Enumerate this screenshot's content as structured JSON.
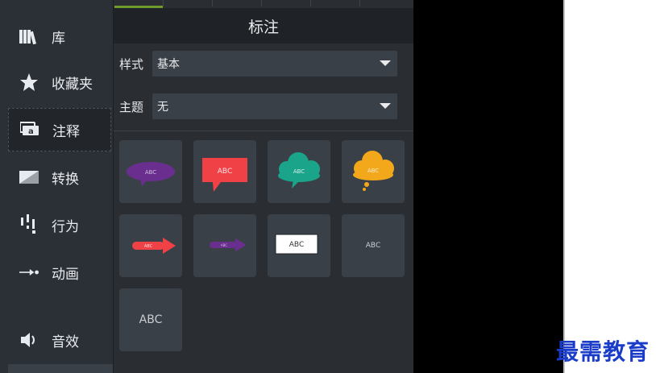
{
  "sidebar": {
    "items": [
      {
        "label": "库",
        "icon": "library-icon"
      },
      {
        "label": "收藏夹",
        "icon": "star-icon"
      },
      {
        "label": "注释",
        "icon": "annotation-icon",
        "active": true
      },
      {
        "label": "转换",
        "icon": "transition-icon"
      },
      {
        "label": "行为",
        "icon": "behavior-icon"
      },
      {
        "label": "动画",
        "icon": "animation-icon"
      },
      {
        "label": "音效",
        "icon": "speaker-icon"
      }
    ]
  },
  "panel": {
    "title": "标注",
    "style": {
      "label": "样式",
      "value": "基本"
    },
    "theme": {
      "label": "主题",
      "value": "无"
    },
    "callouts": [
      {
        "text": "ABC",
        "shape": "purple-speech-bubble"
      },
      {
        "text": "ABC",
        "shape": "red-rectangle-callout"
      },
      {
        "text": "ABC",
        "shape": "teal-cloud"
      },
      {
        "text": "ABC",
        "shape": "orange-thought-cloud"
      },
      {
        "text": "ABC",
        "shape": "red-arrow"
      },
      {
        "text": "ABC",
        "shape": "purple-arrow"
      },
      {
        "text": "ABC",
        "shape": "white-box"
      },
      {
        "text": "ABC",
        "shape": "plain-text-small"
      },
      {
        "text": "ABC",
        "shape": "plain-text-large"
      }
    ]
  },
  "colors": {
    "accent": "#6f9b2d",
    "purple": "#6a2e8f",
    "red": "#f04146",
    "teal": "#1aa58a",
    "orange": "#f3a71b"
  },
  "watermark": "最需教育"
}
